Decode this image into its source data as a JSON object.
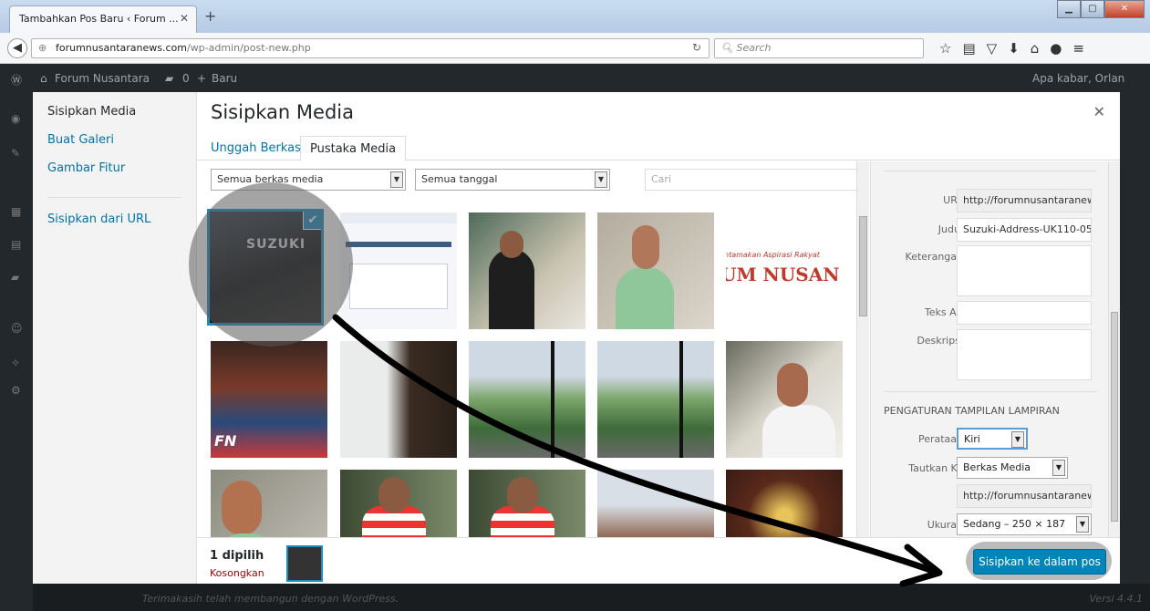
{
  "browser": {
    "tab_title": "Tambahkan Pos Baru ‹ Forum ...",
    "url_domain": "forumnusantaranews.com",
    "url_path": "/wp-admin/post-new.php",
    "search_placeholder": "Search"
  },
  "adminbar": {
    "site_name": "Forum Nusantara",
    "comments_count": "0",
    "new_label": "Baru",
    "greeting": "Apa kabar, Orlan"
  },
  "modal": {
    "title": "Sisipkan Media",
    "menu": {
      "insert_media": "Sisipkan Media",
      "create_gallery": "Buat Galeri",
      "featured_image": "Gambar Fitur",
      "insert_from_url": "Sisipkan dari URL"
    },
    "tabs": {
      "upload": "Unggah Berkas",
      "library": "Pustaka Media"
    },
    "filters": {
      "type_filter": "Semua berkas media",
      "date_filter": "Semua tanggal",
      "search_placeholder": "Cari"
    },
    "details": {
      "url_label": "URL",
      "url_value": "http://forumnusantaranews",
      "title_label": "Judul",
      "title_value": "Suzuki-Address-UK110-05",
      "caption_label": "Keterangan",
      "alt_label": "Teks Alt",
      "description_label": "Deskripsi",
      "settings_title": "PENGATURAN TAMPILAN LAMPIRAN",
      "alignment_label": "Perataan",
      "alignment_value": "Kiri",
      "link_label": "Tautkan Ke",
      "link_value": "Berkas Media",
      "link_url": "http://forumnusantaranews",
      "size_label": "Ukuran",
      "size_value": "Sedang – 250 × 187"
    },
    "toolbar": {
      "selected_count": "1 dipilih",
      "clear_label": "Kosongkan",
      "insert_button": "Sisipkan ke dalam pos"
    },
    "thumb_captions": {
      "suzuki": "SUZUKI",
      "banner": "UM NUSAN",
      "banner_top": "ntamakan Aspirasi Rakyat",
      "fn": "FN"
    }
  },
  "footer": {
    "thanks": "Terimakasih telah membangun dengan WordPress.",
    "version": "Versi 4.4.1"
  }
}
